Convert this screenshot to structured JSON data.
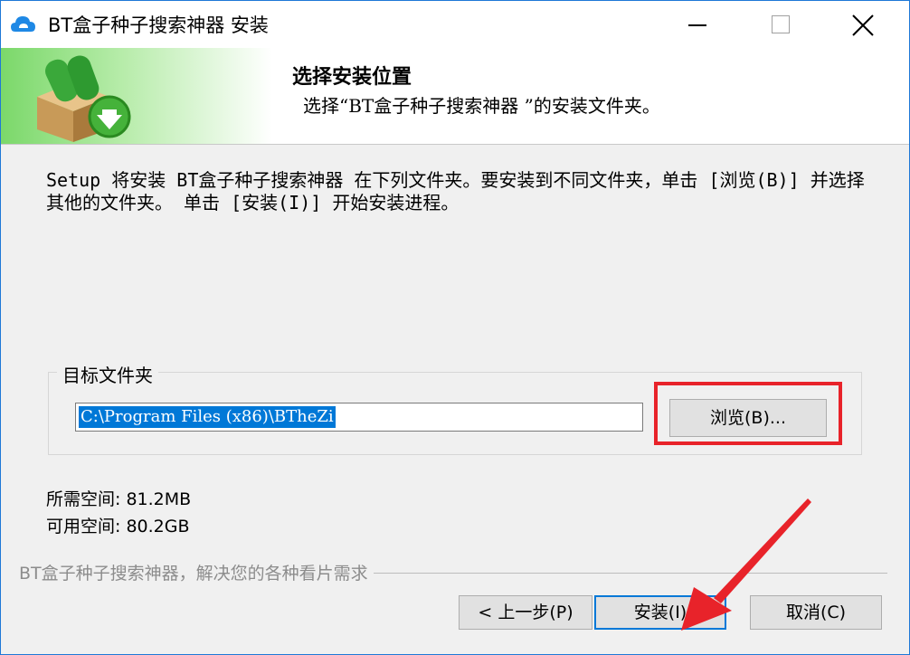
{
  "window": {
    "title": "BT盒子种子搜索神器 安装",
    "icon": "cloud-icon",
    "controls": {
      "minimize": "minimize-icon",
      "maximize": "maximize-icon",
      "close": "close-icon"
    }
  },
  "header": {
    "title": "选择安装位置",
    "subtitle": "选择“BT盒子种子搜索神器 ”的安装文件夹。",
    "logo": "package-download-icon"
  },
  "instructions": "Setup 将安装 BT盒子种子搜索神器  在下列文件夹。要安装到不同文件夹，单击 [浏览(B)] 并选择其他的文件夹。 单击 [安装(I)] 开始安装进程。",
  "destination": {
    "group_label": "目标文件夹",
    "path_value": "C:\\Program Files (x86)\\BTheZi",
    "browse_label": "浏览(B)..."
  },
  "space": {
    "required": "所需空间: 81.2MB",
    "available": "可用空间: 80.2GB"
  },
  "branding": "BT盒子种子搜索神器，解决您的各种看片需求",
  "buttons": {
    "back": "< 上一步(P)",
    "install": "安装(I)",
    "cancel": "取消(C)"
  },
  "colors": {
    "annotation": "#e8232a",
    "selection": "#0078d7",
    "window_border": "#1e78d7"
  }
}
